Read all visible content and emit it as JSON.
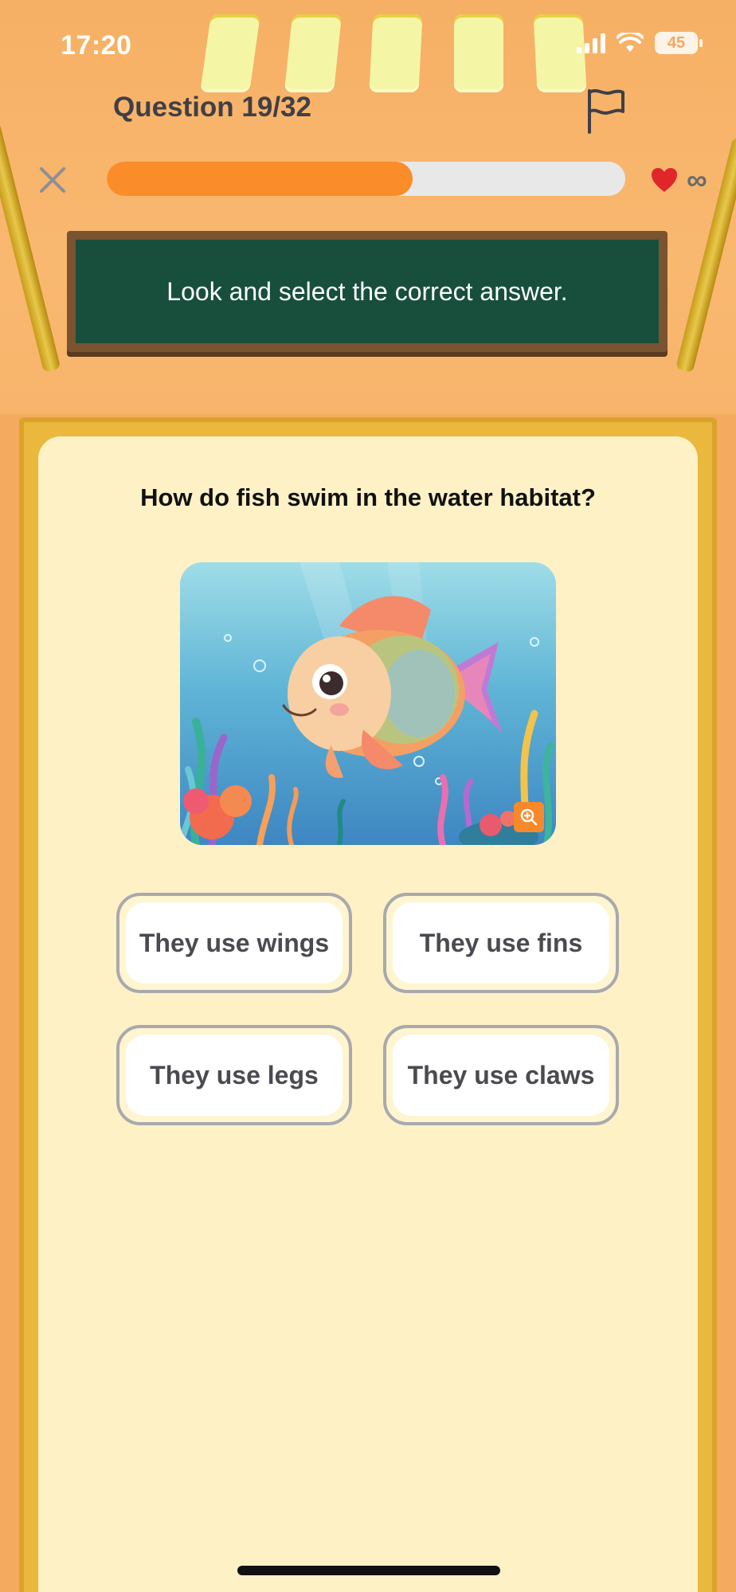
{
  "status_bar": {
    "time": "17:20",
    "battery": "45"
  },
  "header": {
    "question_counter": "Question 19/32",
    "progress": 0.59,
    "lives": "∞"
  },
  "instruction": "Look and select the correct answer.",
  "question": {
    "text": "How do fish swim in the water habitat?"
  },
  "answers": [
    "They use wings",
    "They use fins",
    "They use legs",
    "They use claws"
  ],
  "colors": {
    "accent": "#fb8c2a",
    "board": "#174f3c",
    "card": "#fff1c6",
    "heart": "#e0262a"
  }
}
